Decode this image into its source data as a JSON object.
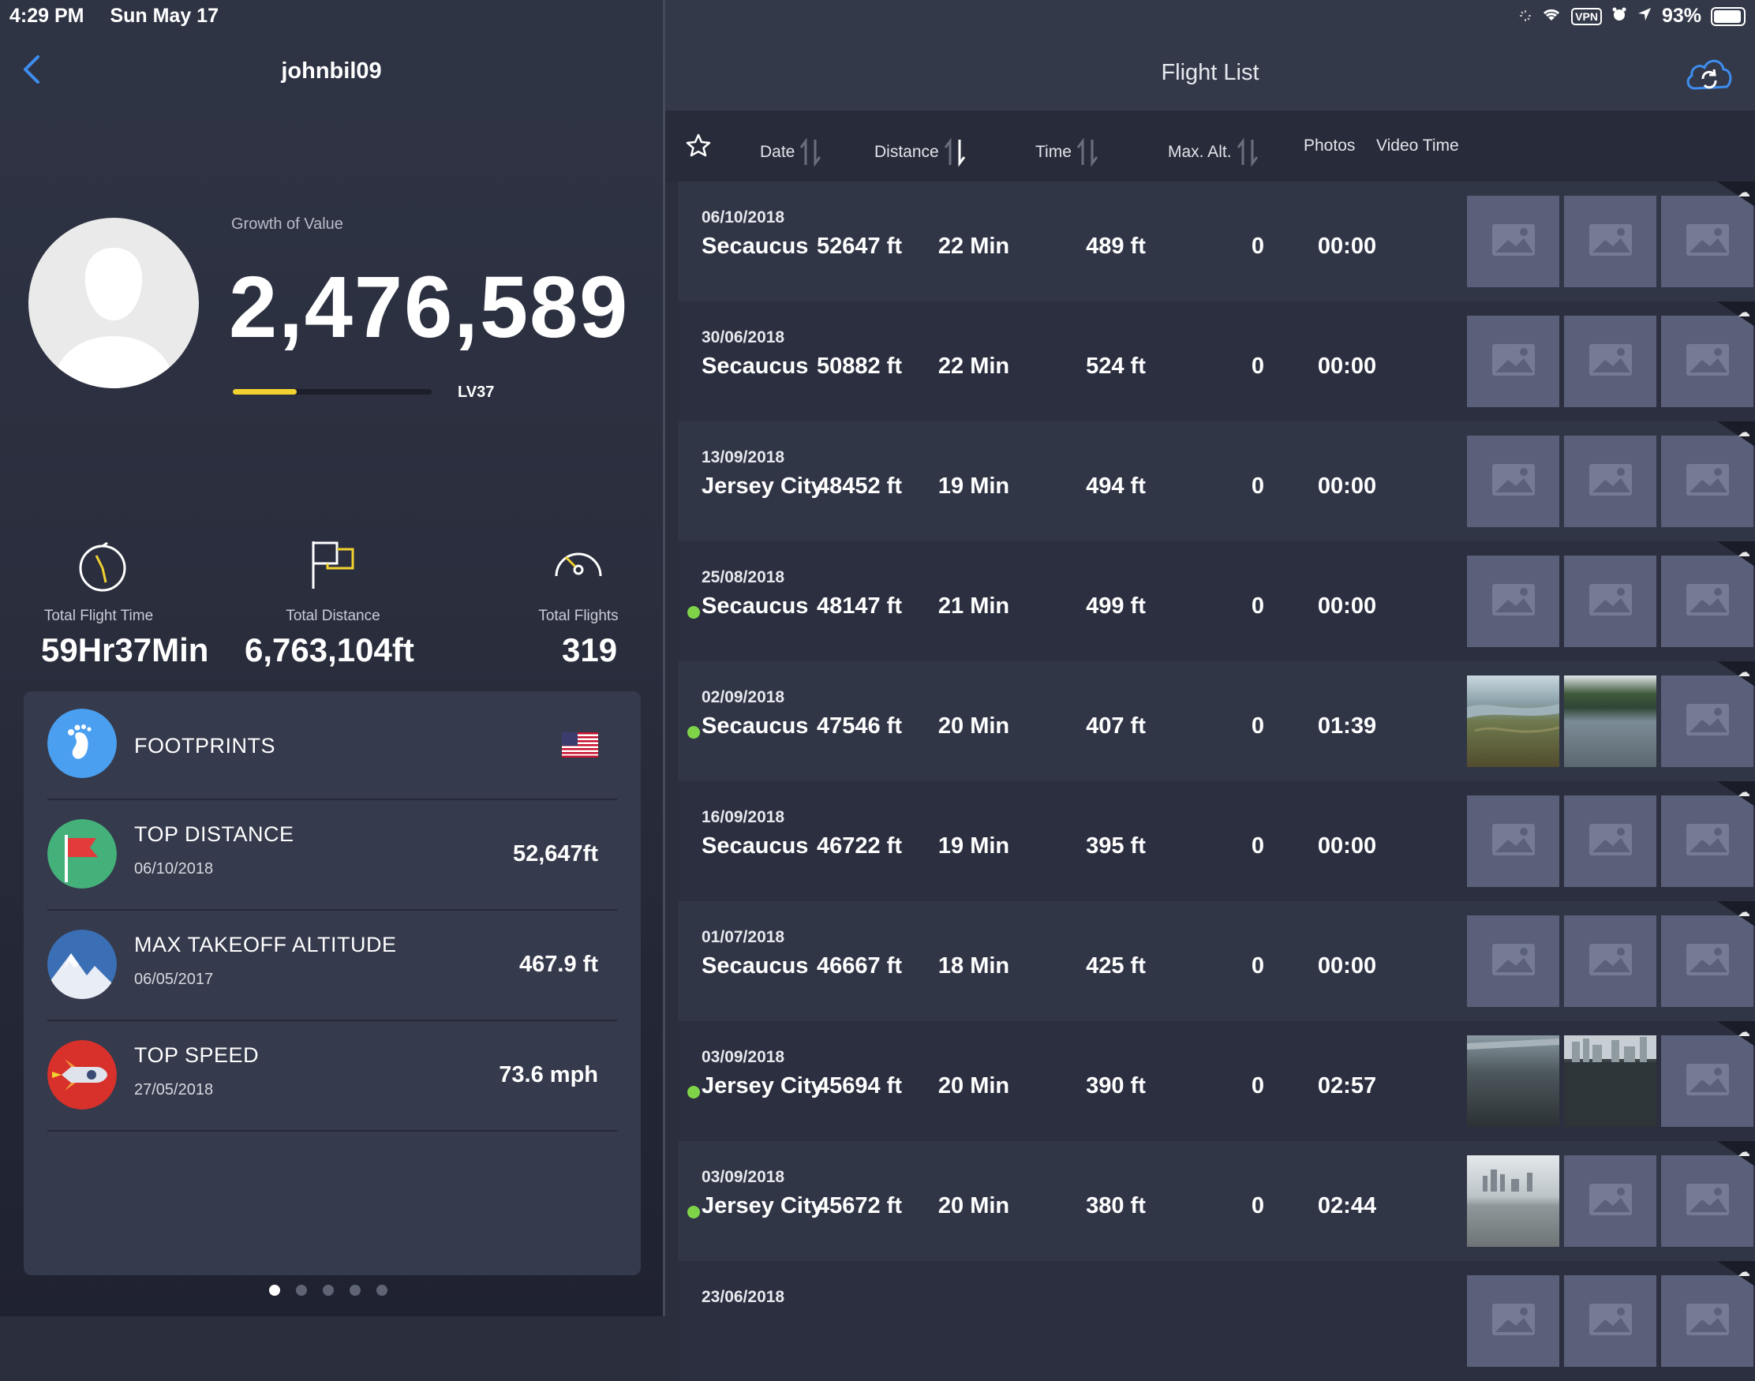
{
  "status_bar": {
    "time": "4:29 PM",
    "date": "Sun May 17",
    "vpn": "VPN",
    "battery": "93%"
  },
  "left": {
    "username": "johnbil09",
    "growth_label": "Growth of Value",
    "growth_value": "2,476,589",
    "level": "LV37",
    "level_progress": 0.32,
    "stats": [
      {
        "icon": "stopwatch-icon",
        "label": "Total Flight Time",
        "value": "59Hr37Min"
      },
      {
        "icon": "flag-icon",
        "label": "Total Distance",
        "value": "6,763,104ft"
      },
      {
        "icon": "speedometer-icon",
        "label": "Total Flights",
        "value": "319"
      }
    ],
    "achievements": [
      {
        "icon": "footprints-icon",
        "title": "FOOTPRINTS",
        "date": "",
        "value": ""
      },
      {
        "icon": "red-flag-icon",
        "title": "TOP DISTANCE",
        "date": "06/10/2018",
        "value": "52,647ft"
      },
      {
        "icon": "mountain-icon",
        "title": "MAX TAKEOFF ALTITUDE",
        "date": "06/05/2017",
        "value": "467.9 ft"
      },
      {
        "icon": "rocket-icon",
        "title": "TOP SPEED",
        "date": "27/05/2018",
        "value": "73.6 mph"
      }
    ],
    "page_dots": 5,
    "active_dot": 0
  },
  "right": {
    "title": "Flight List",
    "columns": {
      "date": "Date",
      "distance": "Distance",
      "time": "Time",
      "max_alt": "Max. Alt.",
      "photos": "Photos",
      "video_time": "Video Time"
    },
    "flights": [
      {
        "date": "06/10/2018",
        "city": "Secaucus",
        "distance": "52647 ft",
        "time": "22 Min",
        "max_alt": "489 ft",
        "photos": "0",
        "video_time": "00:00",
        "dot": false,
        "thumbs": [
          "placeholder",
          "placeholder",
          "placeholder"
        ]
      },
      {
        "date": "30/06/2018",
        "city": "Secaucus",
        "distance": "50882 ft",
        "time": "22 Min",
        "max_alt": "524 ft",
        "photos": "0",
        "video_time": "00:00",
        "dot": false,
        "thumbs": [
          "placeholder",
          "placeholder",
          "placeholder"
        ]
      },
      {
        "date": "13/09/2018",
        "city": "Jersey City",
        "distance": "48452 ft",
        "time": "19 Min",
        "max_alt": "494 ft",
        "photos": "0",
        "video_time": "00:00",
        "dot": false,
        "thumbs": [
          "placeholder",
          "placeholder",
          "placeholder"
        ]
      },
      {
        "date": "25/08/2018",
        "city": "Secaucus",
        "distance": "48147 ft",
        "time": "21 Min",
        "max_alt": "499 ft",
        "photos": "0",
        "video_time": "00:00",
        "dot": true,
        "thumbs": [
          "placeholder",
          "placeholder",
          "placeholder"
        ]
      },
      {
        "date": "02/09/2018",
        "city": "Secaucus",
        "distance": "47546 ft",
        "time": "20 Min",
        "max_alt": "407 ft",
        "photos": "0",
        "video_time": "01:39",
        "dot": true,
        "thumbs": [
          "marsh",
          "lake",
          "placeholder"
        ]
      },
      {
        "date": "16/09/2018",
        "city": "Secaucus",
        "distance": "46722 ft",
        "time": "19 Min",
        "max_alt": "395 ft",
        "photos": "0",
        "video_time": "00:00",
        "dot": false,
        "thumbs": [
          "placeholder",
          "placeholder",
          "placeholder"
        ]
      },
      {
        "date": "01/07/2018",
        "city": "Secaucus",
        "distance": "46667 ft",
        "time": "18 Min",
        "max_alt": "425 ft",
        "photos": "0",
        "video_time": "00:00",
        "dot": false,
        "thumbs": [
          "placeholder",
          "placeholder",
          "placeholder"
        ]
      },
      {
        "date": "03/09/2018",
        "city": "Jersey City",
        "distance": "45694 ft",
        "time": "20 Min",
        "max_alt": "390 ft",
        "photos": "0",
        "video_time": "02:57",
        "dot": true,
        "thumbs": [
          "river",
          "skyline",
          "placeholder"
        ]
      },
      {
        "date": "03/09/2018",
        "city": "Jersey City",
        "distance": "45672 ft",
        "time": "20 Min",
        "max_alt": "380 ft",
        "photos": "0",
        "video_time": "02:44",
        "dot": true,
        "thumbs": [
          "city",
          "placeholder",
          "placeholder"
        ]
      },
      {
        "date": "23/06/2018",
        "city": "",
        "distance": "",
        "time": "",
        "max_alt": "",
        "photos": "",
        "video_time": "",
        "dot": false,
        "thumbs": [
          "placeholder",
          "placeholder",
          "placeholder"
        ]
      }
    ]
  },
  "colors": {
    "accent": "#3d8ef0",
    "level_bar": "#f2d230",
    "status_dot": "#7ed349",
    "flag_badge": "#44b07a",
    "speed_badge": "#d8312b",
    "footprint_badge": "#4a9ff0"
  }
}
